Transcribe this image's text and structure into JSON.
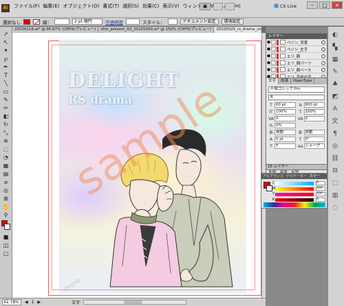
{
  "app": {
    "logo_text": "Ai",
    "menus": [
      "ファイル(F)",
      "編集(E)",
      "オブジェクト(O)",
      "書式(T)",
      "選択(S)",
      "効果(C)",
      "表示(V)",
      "ウィンドウ(W)",
      "ヘルプ(H)"
    ],
    "cs_live": "CS Live"
  },
  "control_bar": {
    "selection_label": "選択なし",
    "stroke_label": "線：",
    "stroke_width": "2 pt 楕円",
    "opacity_label": "不透明度",
    "style_label": "スタイル：",
    "doc_settings_btn": "ドキュメント設定",
    "prefs_btn": "環境設定",
    "text_label": "文字",
    "paragraph_label": "段落"
  },
  "tabs": [
    "20100116.ai* @ 66.67% (CMYK/プレビュー)",
    "zhin_present_A3_20101009.ai* @ 150% (CMYK/プレビュー)",
    "20100525_rs_drama_color.ai* @ 42.78% (CMYK/プレビュー)"
  ],
  "artwork": {
    "title": "DELIGHT",
    "subtitle": "RS drama",
    "watermark": "sample",
    "watermark_small": "mono"
  },
  "status_bar": {
    "zoom": "42.78%",
    "page": "1",
    "tool_name": "文字"
  },
  "layers_panel": {
    "header": "レイヤー",
    "rows": [
      "ペジン_背景",
      "ペジン_左手",
      "エリ_顔",
      "エリ_顔パーツ",
      "エリ_顔ベース",
      "エリ_手前の手"
    ]
  },
  "character_panel": {
    "tabs": [
      "文字",
      "段落",
      "OpenType"
    ],
    "font": "小塚ゴシック Pro",
    "style": "R",
    "fields": [
      {
        "icon": "T",
        "value": "60 pt"
      },
      {
        "icon": "A",
        "value": "600 pt"
      },
      {
        "icon": "IT",
        "value": "100%"
      },
      {
        "icon": "T",
        "value": "100%"
      },
      {
        "icon": "VA",
        "value": "0"
      },
      {
        "icon": "VA",
        "value": "0"
      },
      {
        "icon": "%",
        "value": "0%"
      },
      {
        "icon": "",
        "value": ""
      },
      {
        "icon": "あ",
        "value": "自動"
      },
      {
        "icon": "あ",
        "value": "自動"
      },
      {
        "icon": "A",
        "value": "0 pt"
      },
      {
        "icon": "T",
        "value": "0°"
      },
      {
        "icon": "T",
        "value": "T"
      },
      {
        "icon": "aa",
        "value": "シャープ"
      }
    ],
    "language": "言語：英語：米国"
  },
  "layer_count": "15 レイヤー",
  "color_panel": {
    "tabs": [
      "アピアランス",
      "ナビゲーター",
      "カラー"
    ],
    "sliders": [
      {
        "label": "C",
        "value": "0",
        "fill": 0
      },
      {
        "label": "M",
        "value": "100",
        "fill": 1.0
      },
      {
        "label": "Y",
        "value": "100",
        "fill": 1.0
      },
      {
        "label": "K",
        "value": "0",
        "fill": 0
      }
    ],
    "fill_color": "#e00000"
  },
  "right_strip": {
    "labels": [
      "カラー",
      "カラーガイド",
      "スウォッチ",
      "ブラシ",
      "シンボル",
      "グラフィック",
      "ア",
      "文",
      "段",
      "アピ",
      "リンク",
      "整",
      "変形",
      "グラデ",
      "透明"
    ]
  },
  "colors": {
    "accent_red": "#e00000",
    "ui_gray": "#cbcbcb",
    "panel_header": "#5b5b5b"
  }
}
